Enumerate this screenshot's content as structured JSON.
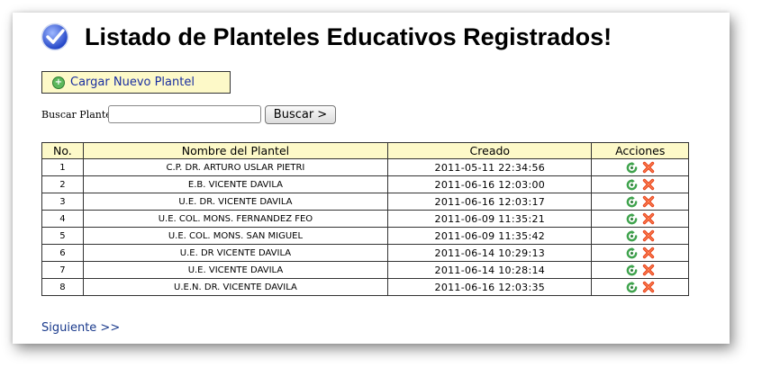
{
  "page": {
    "title": "Listado de Planteles Educativos Registrados!"
  },
  "toolbar": {
    "new_label": "Cargar Nuevo Plantel"
  },
  "search": {
    "label": "Buscar Plantel:",
    "value": "",
    "button_label": "Buscar >"
  },
  "table": {
    "headers": [
      "No.",
      "Nombre del Plantel",
      "Creado",
      "Acciones"
    ],
    "rows": [
      {
        "no": "1",
        "name": "C.P. DR. ARTURO USLAR PIETRI",
        "created": "2011-05-11 22:34:56"
      },
      {
        "no": "2",
        "name": "E.B. VICENTE DAVILA",
        "created": "2011-06-16 12:03:00"
      },
      {
        "no": "3",
        "name": "U.E. DR. VICENTE DAVILA",
        "created": "2011-06-16 12:03:17"
      },
      {
        "no": "4",
        "name": "U.E. COL. MONS. FERNANDEZ FEO",
        "created": "2011-06-09 11:35:21"
      },
      {
        "no": "5",
        "name": "U.E. COL. MONS. SAN MIGUEL",
        "created": "2011-06-09 11:35:42"
      },
      {
        "no": "6",
        "name": "U.E. DR VICENTE DAVILA",
        "created": "2011-06-14 10:29:13"
      },
      {
        "no": "7",
        "name": "U.E. VICENTE DAVILA",
        "created": "2011-06-14 10:28:14"
      },
      {
        "no": "8",
        "name": "U.E.N. DR. VICENTE DAVILA",
        "created": "2011-06-16 12:03:35"
      }
    ]
  },
  "pagination": {
    "next_label": "Siguiente >>"
  },
  "icons": {
    "title": "check-circle-icon",
    "new": "plus-circle-icon",
    "edit": "refresh-edit-icon",
    "delete": "red-x-icon"
  },
  "colors": {
    "highlight": "#fdf9c8",
    "link": "#1a3a8c",
    "edit": "#3fa34d",
    "delete": "#e8461e"
  }
}
